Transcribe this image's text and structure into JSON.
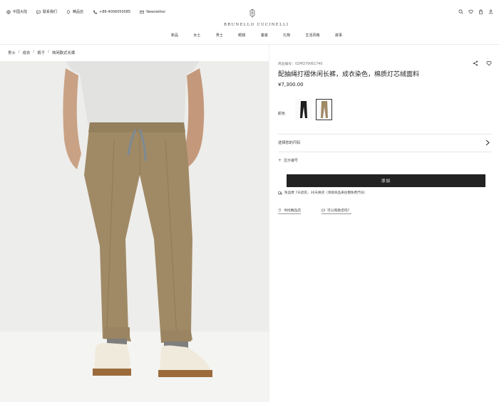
{
  "header": {
    "util": [
      {
        "icon": "globe-icon",
        "label": "中国大陆"
      },
      {
        "icon": "chat-icon",
        "label": "联系我们"
      },
      {
        "icon": "location-pin-icon",
        "label": "精品店"
      },
      {
        "icon": "phone-icon",
        "label": "+86-4006050085"
      },
      {
        "icon": "mail-icon",
        "label": "Newsletter"
      }
    ],
    "brand": "BRUNELLO CUCINELLI",
    "right_icons": [
      "search-icon",
      "wishlist-heart-icon",
      "bag-icon",
      "account-icon"
    ]
  },
  "nav": [
    "新品",
    "女士",
    "男士",
    "眼镜",
    "童装",
    "礼物",
    "生活风格",
    "故事"
  ],
  "breadcrumb": [
    "男士",
    "成衣",
    "裤子",
    "休闲款式长裤"
  ],
  "product": {
    "code": "商品编号：02MQ79061740",
    "title": "配抽绳打褶休闲长裤，成衣染色，棉质灯芯绒面料",
    "price": "¥7,300.00",
    "color_label": "颜色",
    "size_label": "选择您的尺码",
    "reminder": "显示编号",
    "add_label": "添加",
    "shipping": "免运费 7天退货，30天换货（领取商品来往都免费尺码）",
    "link_boutique": "寻找精品店",
    "link_help": "可以帮助您吗？"
  },
  "colors": {
    "accent": "#222222",
    "photo_bg": "#ededeb",
    "trousers": "#a08a66"
  }
}
